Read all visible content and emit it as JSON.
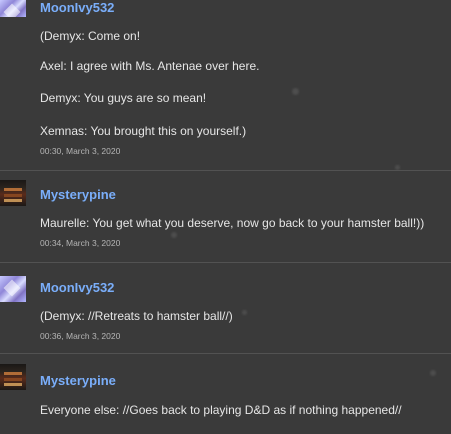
{
  "thread": {
    "comments": [
      {
        "user": "MoonIvy532",
        "avatar": "crystal-avatar",
        "lines": [
          "(Demyx: Come on!",
          "Axel: I agree with Ms. Antenae over here.",
          "Demyx: You guys are so mean!",
          "Xemnas: You brought this on yourself.)"
        ],
        "timestamp": "00:30, March 3, 2020"
      },
      {
        "user": "Mysterypine",
        "avatar": "dark-avatar",
        "lines": [
          "Maurelle: You get what you deserve, now go back to your hamster ball!))"
        ],
        "timestamp": "00:34, March 3, 2020"
      },
      {
        "user": "MoonIvy532",
        "avatar": "crystal-avatar",
        "lines": [
          "(Demyx: //Retreats to hamster ball//)"
        ],
        "timestamp": "00:36, March 3, 2020"
      },
      {
        "user": "Mysterypine",
        "avatar": "dark-avatar",
        "lines": [
          "Everyone else: //Goes back to playing D&D as if nothing happened//"
        ]
      }
    ]
  },
  "colors": {
    "background": "#3a3a3a",
    "username": "#7aaefa",
    "text": "#e6e6e6",
    "timestamp": "#b5b5b5",
    "divider": "#525252"
  }
}
